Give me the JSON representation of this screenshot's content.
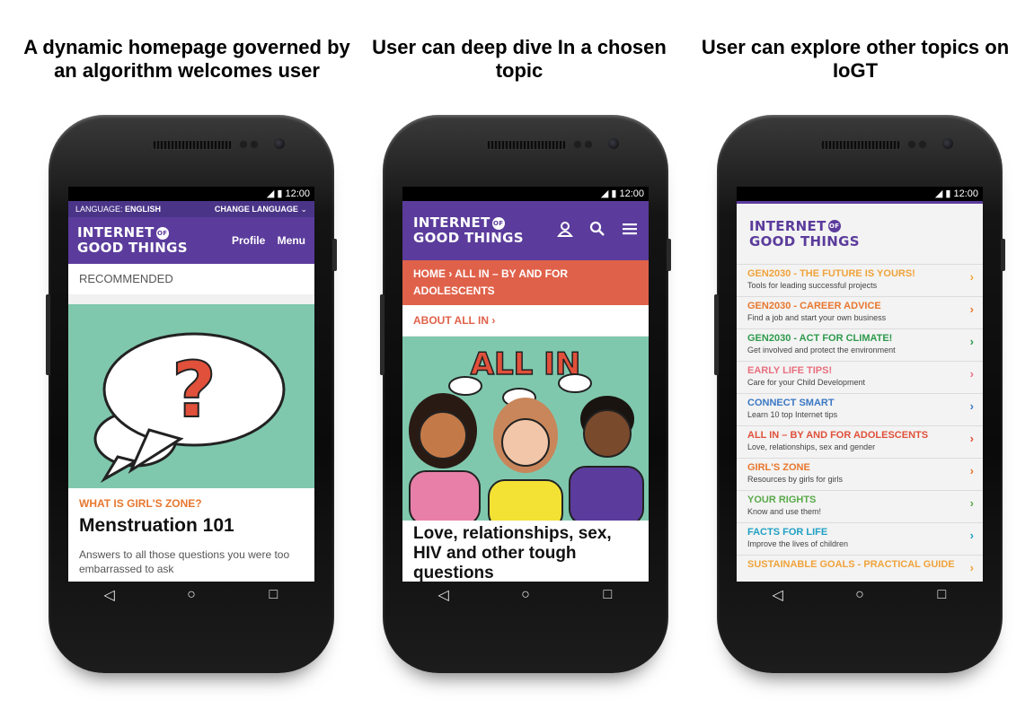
{
  "captions": [
    "A dynamic homepage governed by an algorithm welcomes user",
    "User can deep dive In a chosen topic",
    "User can explore other topics on IoGT"
  ],
  "status_time": "12:00",
  "logo": {
    "line1": "INTERNET",
    "of": "OF",
    "line2": "GOOD THINGS"
  },
  "nav_icons": [
    "back-icon",
    "home-icon",
    "recents-icon"
  ],
  "screen1": {
    "language_label": "LANGUAGE:",
    "language_value": "ENGLISH",
    "change_language": "CHANGE LANGUAGE",
    "profile": "Profile",
    "menu": "Menu",
    "recommended": "RECOMMENDED",
    "eyebrow": "WHAT IS GIRL'S ZONE?",
    "title": "Menstruation 101",
    "description": "Answers to all those questions you were too embarrassed to ask"
  },
  "screen2": {
    "breadcrumb": "HOME › ALL IN – BY AND FOR ADOLESCENTS",
    "about": "ABOUT ALL IN ›",
    "hero_text": "ALL IN",
    "title": "Love, relationships, sex, HIV and other tough questions"
  },
  "screen3": {
    "topics": [
      {
        "label": "GEN2030 - THE FUTURE IS YOURS!",
        "sub": "Tools for leading successful projects",
        "color": "#f0a33a"
      },
      {
        "label": "GEN2030 - CAREER ADVICE",
        "sub": "Find a job and start your own business",
        "color": "#e8772e"
      },
      {
        "label": "GEN2030 - ACT FOR CLIMATE!",
        "sub": "Get involved and protect the environment",
        "color": "#2e9a4c"
      },
      {
        "label": "EARLY LIFE TIPS!",
        "sub": "Care for your Child Development",
        "color": "#e86f7f"
      },
      {
        "label": "CONNECT SMART",
        "sub": "Learn 10 top Internet tips",
        "color": "#3b78c4"
      },
      {
        "label": "ALL IN – BY AND FOR ADOLESCENTS",
        "sub": "Love, relationships, sex and gender",
        "color": "#e0503a"
      },
      {
        "label": "GIRL'S ZONE",
        "sub": "Resources by girls for girls",
        "color": "#e8772e"
      },
      {
        "label": "YOUR RIGHTS",
        "sub": "Know and use them!",
        "color": "#5aaa4a"
      },
      {
        "label": "FACTS FOR LIFE",
        "sub": "Improve the lives of children",
        "color": "#1fa0c4"
      },
      {
        "label": "SUSTAINABLE GOALS - PRACTICAL GUIDE",
        "sub": "",
        "color": "#f0a33a"
      }
    ]
  }
}
